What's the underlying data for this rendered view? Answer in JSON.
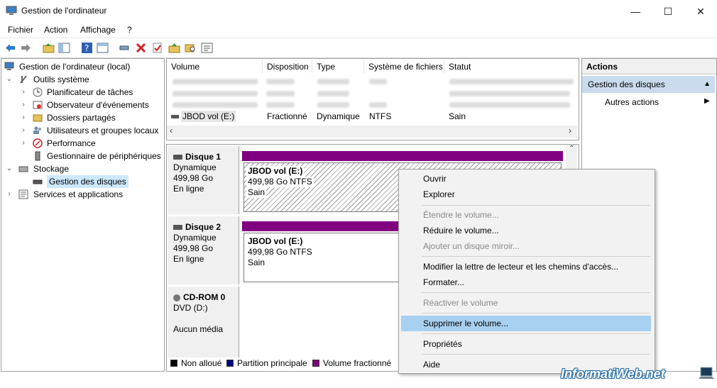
{
  "window": {
    "title": "Gestion de l'ordinateur"
  },
  "menubar": [
    "Fichier",
    "Action",
    "Affichage",
    "?"
  ],
  "tree": {
    "root": "Gestion de l'ordinateur (local)",
    "system_tools": "Outils système",
    "task_scheduler": "Planificateur de tâches",
    "event_viewer": "Observateur d'événements",
    "shared_folders": "Dossiers partagés",
    "local_users": "Utilisateurs et groupes locaux",
    "performance": "Performance",
    "device_manager": "Gestionnaire de périphériques",
    "storage": "Stockage",
    "disk_management": "Gestion des disques",
    "services_apps": "Services et applications"
  },
  "volume_list": {
    "columns": [
      "Volume",
      "Disposition",
      "Type",
      "Système de fichiers",
      "Statut"
    ],
    "row": {
      "volume": "JBOD vol (E:)",
      "layout": "Fractionné",
      "type": "Dynamique",
      "fs": "NTFS",
      "status": "Sain"
    }
  },
  "disks": [
    {
      "name": "Disque 1",
      "type": "Dynamique",
      "size": "499,98 Go",
      "state": "En ligne",
      "volume": {
        "name": "JBOD vol  (E:)",
        "info": "499,98 Go NTFS",
        "status": "Sain"
      }
    },
    {
      "name": "Disque 2",
      "type": "Dynamique",
      "size": "499,98 Go",
      "state": "En ligne",
      "volume": {
        "name": "JBOD vol  (E:)",
        "info": "499,98 Go NTFS",
        "status": "Sain"
      }
    },
    {
      "name": "CD-ROM 0",
      "type": "DVD (D:)",
      "state": "Aucun média"
    }
  ],
  "legend": [
    {
      "label": "Non alloué",
      "color": "#000000"
    },
    {
      "label": "Partition principale",
      "color": "#000080"
    },
    {
      "label": "Volume fractionné",
      "color": "#800080"
    }
  ],
  "actions": {
    "header": "Actions",
    "section": "Gestion des disques",
    "more": "Autres actions"
  },
  "context_menu": {
    "open": "Ouvrir",
    "explore": "Explorer",
    "extend": "Étendre le volume...",
    "shrink": "Réduire le volume...",
    "add_mirror": "Ajouter un disque miroir...",
    "change_letter": "Modifier la lettre de lecteur et les chemins d'accès...",
    "format": "Formater...",
    "reactivate": "Réactiver le volume",
    "delete": "Supprimer le volume...",
    "properties": "Propriétés",
    "help": "Aide"
  },
  "watermark": "InformatiWeb.net"
}
